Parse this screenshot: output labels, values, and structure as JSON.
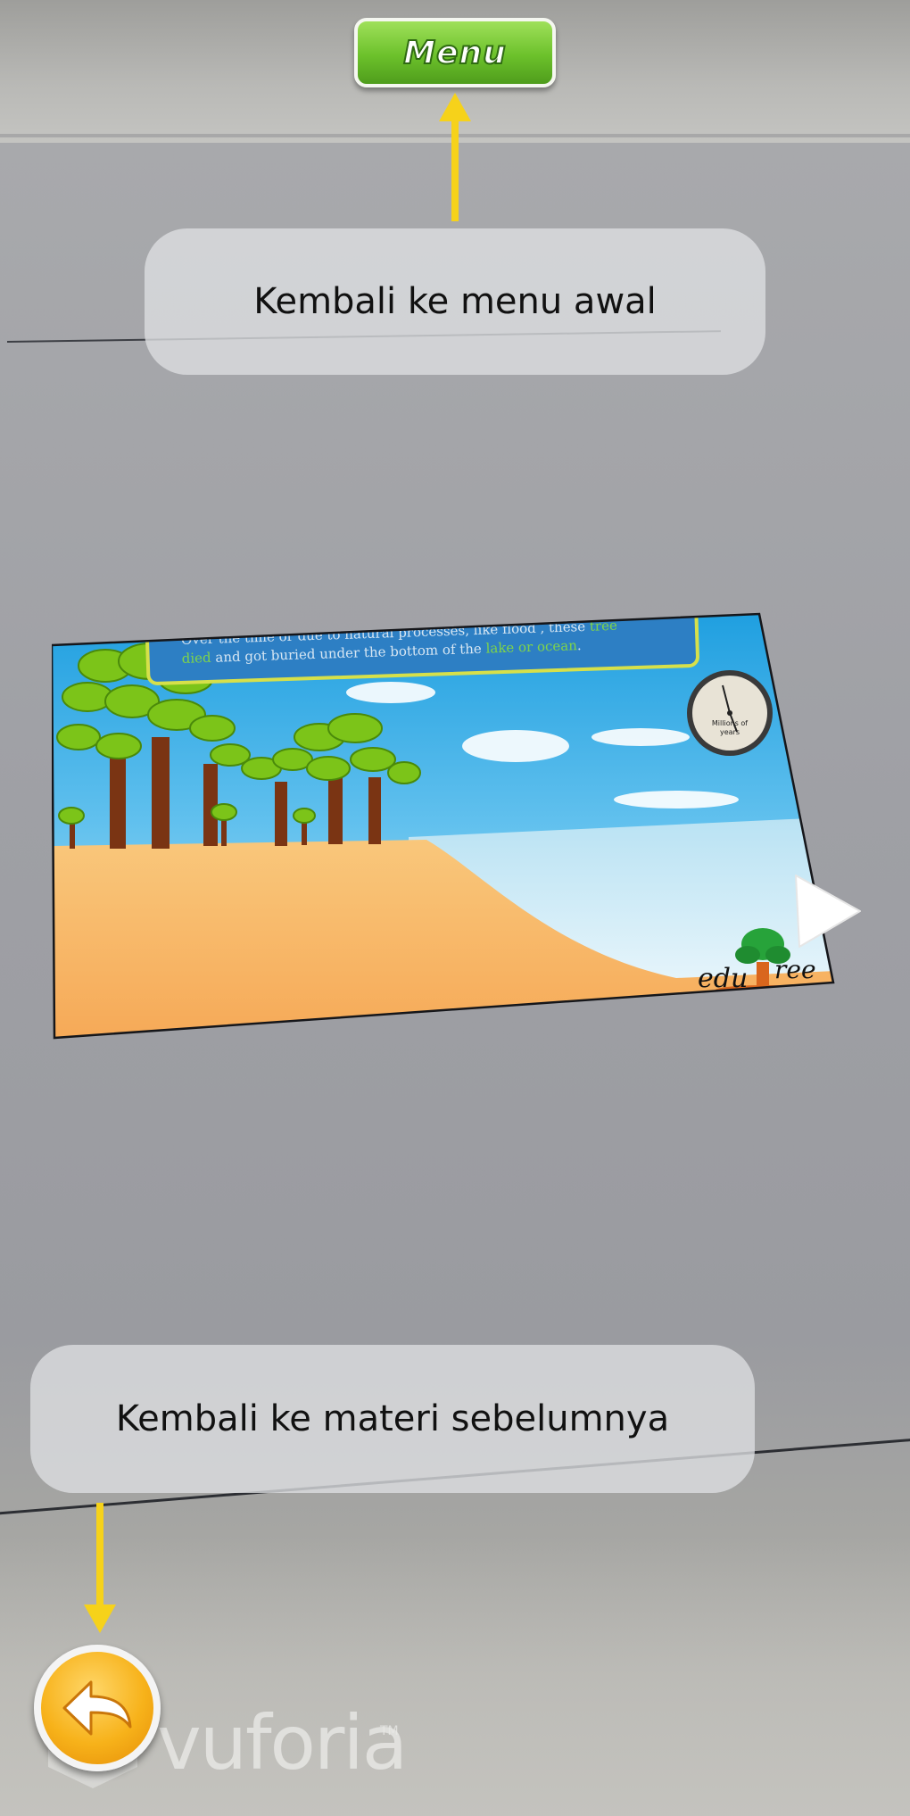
{
  "top_button": {
    "label": "Menu"
  },
  "callouts": {
    "menu_hint": "Kembali ke menu awal",
    "back_hint": "Kembali ke materi sebelumnya"
  },
  "ar_scene": {
    "caption_part1": "Over the time or due to natural processes, like flood , these ",
    "caption_highlight1": "tree",
    "caption_part2": "died",
    "caption_part3": " and got buried under the bottom of the ",
    "caption_highlight2": "lake or ocean",
    "caption_end": ".",
    "gauge_label_line1": "Millions of",
    "gauge_label_line2": "years",
    "brand_left": "edu",
    "brand_right": "ree"
  },
  "watermark": {
    "text": "vuforia",
    "tm": "TM"
  },
  "colors": {
    "arrow_yellow": "#f6d21a",
    "menu_green": "#6cc12b",
    "back_orange": "#f7b21a",
    "caption_highlight": "#7fd44a"
  },
  "icons": {
    "back_button": "arrow-left-icon",
    "next_button": "play-arrow-icon",
    "gauge": "stopwatch-icon"
  }
}
